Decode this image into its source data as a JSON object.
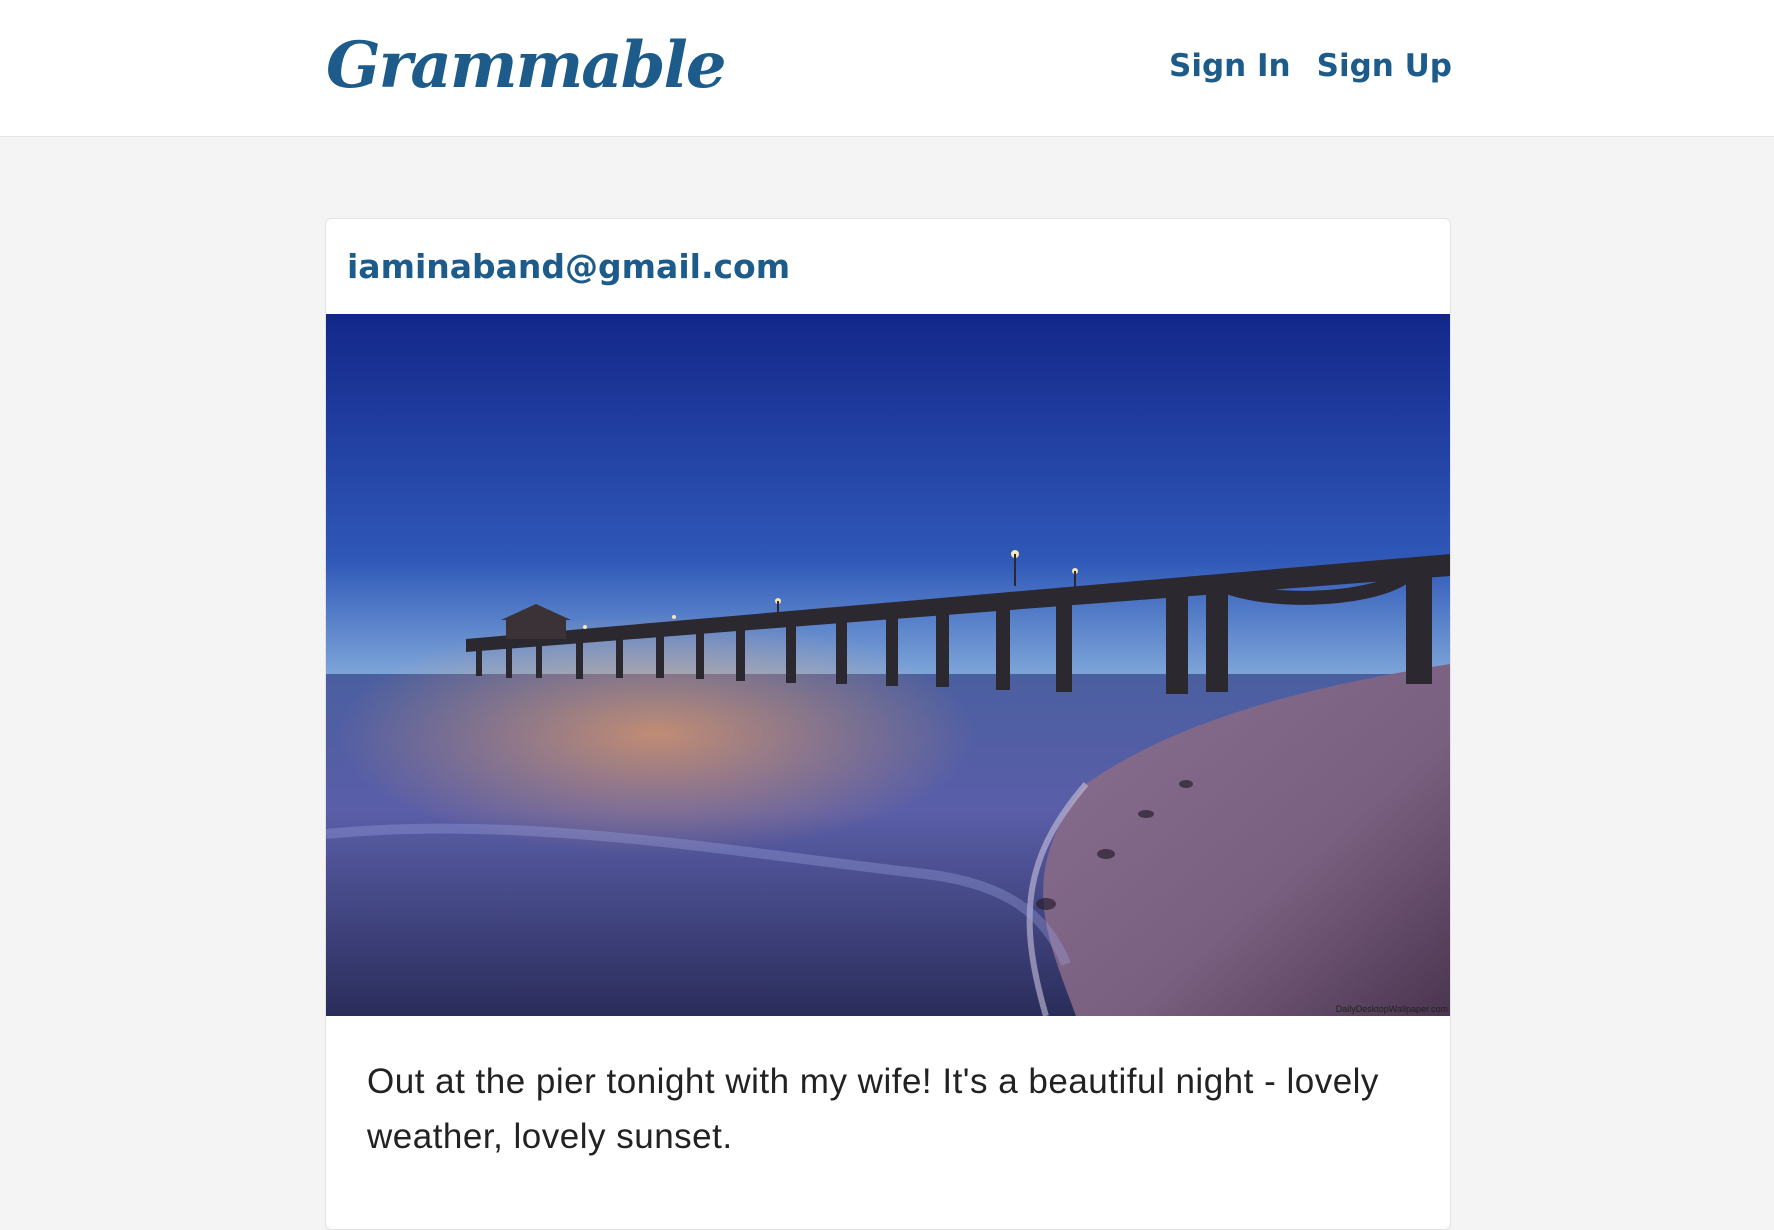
{
  "navbar": {
    "brand": "Grammable",
    "links": [
      {
        "label": "Sign In"
      },
      {
        "label": "Sign Up"
      }
    ]
  },
  "post": {
    "author": "iaminaband@gmail.com",
    "caption": "Out at the pier tonight with my wife! It's a beautiful night - lovely weather, lovely sunset.",
    "photo_watermark": "DailyDesktopWallpaper.com"
  },
  "colors": {
    "brand": "#1d5c8a",
    "background": "#f4f4f4",
    "card": "#ffffff",
    "text": "#222222"
  }
}
